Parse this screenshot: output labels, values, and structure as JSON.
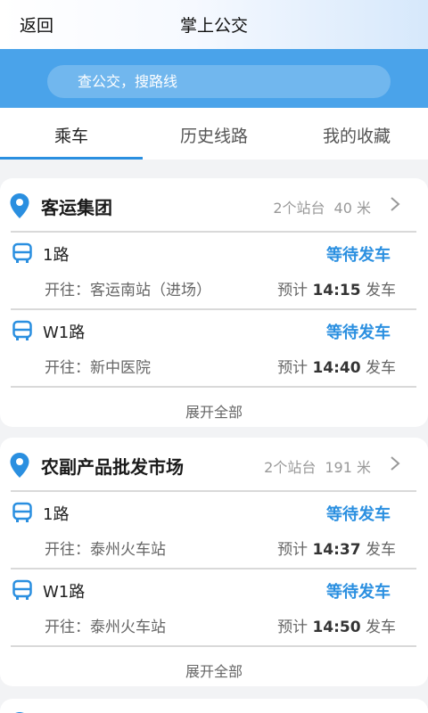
{
  "header": {
    "back_label": "返回",
    "title": "掌上公交"
  },
  "search": {
    "placeholder": "查公交，搜路线"
  },
  "tabs": [
    {
      "label": "乘车",
      "active": true
    },
    {
      "label": "历史线路",
      "active": false
    },
    {
      "label": "我的收藏",
      "active": false
    }
  ],
  "stations": [
    {
      "name": "客运集团",
      "platforms": "2个站台",
      "distance": "40 米",
      "routes": [
        {
          "name": "1路",
          "status": "等待发车",
          "dest_prefix": "开往：",
          "dest": "客运南站（进场）",
          "eta_prefix": "预计",
          "eta_time": "14:15",
          "eta_suffix": "发车"
        },
        {
          "name": "W1路",
          "status": "等待发车",
          "dest_prefix": "开往：",
          "dest": "新中医院",
          "eta_prefix": "预计",
          "eta_time": "14:40",
          "eta_suffix": "发车"
        }
      ],
      "expand_label": "展开全部"
    },
    {
      "name": "农副产品批发市场",
      "platforms": "2个站台",
      "distance": "191 米",
      "routes": [
        {
          "name": "1路",
          "status": "等待发车",
          "dest_prefix": "开往：",
          "dest": "泰州火车站",
          "eta_prefix": "预计",
          "eta_time": "14:37",
          "eta_suffix": "发车"
        },
        {
          "name": "W1路",
          "status": "等待发车",
          "dest_prefix": "开往：",
          "dest": "泰州火车站",
          "eta_prefix": "预计",
          "eta_time": "14:50",
          "eta_suffix": "发车"
        }
      ],
      "expand_label": "展开全部"
    }
  ],
  "colors": {
    "accent": "#2a8fe0",
    "search_band": "#4aa3ea",
    "background": "#f2f3f5"
  },
  "icons": {
    "location": "location-pin-icon",
    "bus": "bus-icon",
    "chevron": "chevron-right-icon"
  }
}
